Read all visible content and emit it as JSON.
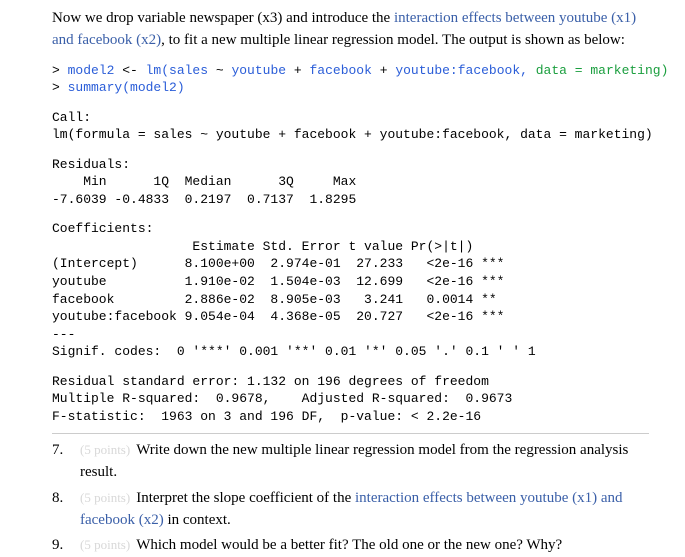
{
  "intro": {
    "part1": "Now we drop variable newspaper (x3) and introduce the ",
    "link1": "interaction effects between youtube (x1) and facebook (x2)",
    "part2": ", to fit a new multiple linear regression model. The output is shown as below:"
  },
  "cmd": {
    "line1a": "> ",
    "line1b": "model2 ",
    "line1c": "<- ",
    "line1d": "lm(sales ",
    "line1e": "~ ",
    "line1f": "youtube ",
    "line1g": "+ ",
    "line1h": "facebook ",
    "line1i": "+ ",
    "line1j": "youtube:facebook, ",
    "line1k": "data = marketing)",
    "line2a": "> ",
    "line2b": "summary(model2)"
  },
  "output": {
    "call_label": "Call:",
    "call_text": "lm(formula = sales ~ youtube + facebook + youtube:facebook, data = marketing)",
    "resid_label": "Residuals:",
    "resid_header": "    Min      1Q  Median      3Q     Max",
    "resid_values": "-7.6039 -0.4833  0.2197  0.7137  1.8295",
    "coef_label": "Coefficients:",
    "coef_header": "                  Estimate Std. Error t value Pr(>|t|)",
    "coef_rows": [
      "(Intercept)      8.100e+00  2.974e-01  27.233   <2e-16 ***",
      "youtube          1.910e-02  1.504e-03  12.699   <2e-16 ***",
      "facebook         2.886e-02  8.905e-03   3.241   0.0014 **",
      "youtube:facebook 9.054e-04  4.368e-05  20.727   <2e-16 ***"
    ],
    "dashes": "---",
    "signif": "Signif. codes:  0 '***' 0.001 '**' 0.01 '*' 0.05 '.' 0.1 ' ' 1",
    "rse": "Residual standard error: 1.132 on 196 degrees of freedom",
    "r2": "Multiple R-squared:  0.9678,    Adjusted R-squared:  0.9673",
    "fstat": "F-statistic:  1963 on 3 and 196 DF,  p-value: < 2.2e-16"
  },
  "questions": [
    {
      "num": "7.",
      "points": "(5 points)",
      "text_pre": "Write down the new multiple linear regression model from the regression analysis result.",
      "link": "",
      "text_post": ""
    },
    {
      "num": "8.",
      "points": "(5 points)",
      "text_pre": "Interpret the slope coefficient of the ",
      "link": "interaction effects between youtube (x1) and facebook (x2)",
      "text_post": " in context."
    },
    {
      "num": "9.",
      "points": "(5 points)",
      "text_pre": "Which model would be a better fit? The old one or the new one? Why?",
      "link": "",
      "text_post": ""
    }
  ],
  "chart_data": {
    "type": "table",
    "title": "Coefficients",
    "columns": [
      "",
      "Estimate",
      "Std. Error",
      "t value",
      "Pr(>|t|)",
      "signif"
    ],
    "rows": [
      [
        "(Intercept)",
        8.1,
        0.2974,
        27.233,
        "<2e-16",
        "***"
      ],
      [
        "youtube",
        0.0191,
        0.001504,
        12.699,
        "<2e-16",
        "***"
      ],
      [
        "facebook",
        0.02886,
        0.008905,
        3.241,
        0.0014,
        "**"
      ],
      [
        "youtube:facebook",
        0.0009054,
        4.368e-05,
        20.727,
        "<2e-16",
        "***"
      ]
    ],
    "residuals": {
      "Min": -7.6039,
      "1Q": -0.4833,
      "Median": 0.2197,
      "3Q": 0.7137,
      "Max": 1.8295
    },
    "rse": 1.132,
    "df_resid": 196,
    "r_squared": 0.9678,
    "adj_r_squared": 0.9673,
    "f_statistic": 1963,
    "f_df": [
      3,
      196
    ],
    "p_value": "< 2.2e-16"
  }
}
